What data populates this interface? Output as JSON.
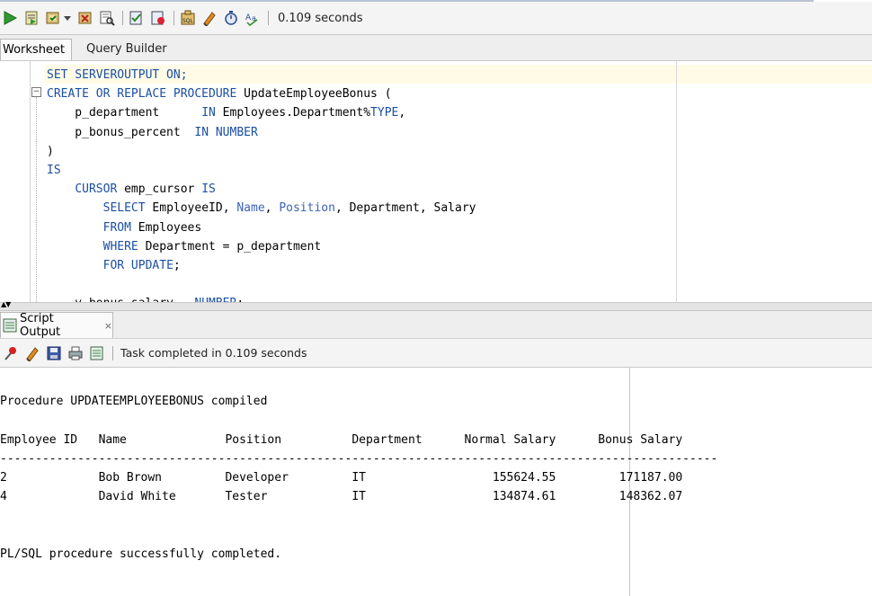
{
  "toolbar": {
    "icons": [
      "run-statement-icon",
      "run-script-icon",
      "commit-icon",
      "dropdown-arrow-icon",
      "rollback-icon",
      "explain-plan-icon",
      "autotrace-icon",
      "sql-tuning-icon",
      "sql-history-icon",
      "clear-icon",
      "timer-icon",
      "format-icon"
    ],
    "elapsed": "0.109 seconds"
  },
  "tabs": {
    "worksheet": "Worksheet",
    "query_builder": "Query Builder"
  },
  "editor": {
    "lines": [
      [
        {
          "t": "SET SERVEROUTPUT ON;",
          "c": "kw"
        }
      ],
      [
        {
          "t": "CREATE OR REPLACE PROCEDURE ",
          "c": "kw"
        },
        {
          "t": "UpdateEmployeeBonus (",
          "c": ""
        }
      ],
      [
        {
          "t": "    p_department      ",
          "c": ""
        },
        {
          "t": "IN ",
          "c": "kw"
        },
        {
          "t": "Employees.Department%",
          "c": ""
        },
        {
          "t": "TYPE",
          "c": "kw"
        },
        {
          "t": ",",
          "c": ""
        }
      ],
      [
        {
          "t": "    p_bonus_percent  ",
          "c": ""
        },
        {
          "t": "IN NUMBER",
          "c": "kw"
        }
      ],
      [
        {
          "t": ")",
          "c": ""
        }
      ],
      [
        {
          "t": "IS",
          "c": "kw"
        }
      ],
      [
        {
          "t": "    ",
          "c": ""
        },
        {
          "t": "CURSOR ",
          "c": "kw"
        },
        {
          "t": "emp_cursor ",
          "c": ""
        },
        {
          "t": "IS",
          "c": "kw"
        }
      ],
      [
        {
          "t": "        ",
          "c": ""
        },
        {
          "t": "SELECT ",
          "c": "kw"
        },
        {
          "t": "EmployeeID, ",
          "c": ""
        },
        {
          "t": "Name",
          "c": "pkw"
        },
        {
          "t": ", ",
          "c": ""
        },
        {
          "t": "Position",
          "c": "pkw"
        },
        {
          "t": ", Department, Salary",
          "c": ""
        }
      ],
      [
        {
          "t": "        ",
          "c": ""
        },
        {
          "t": "FROM ",
          "c": "kw"
        },
        {
          "t": "Employees",
          "c": ""
        }
      ],
      [
        {
          "t": "        ",
          "c": ""
        },
        {
          "t": "WHERE ",
          "c": "kw"
        },
        {
          "t": "Department = p_department",
          "c": ""
        }
      ],
      [
        {
          "t": "        ",
          "c": ""
        },
        {
          "t": "FOR UPDATE",
          "c": "kw"
        },
        {
          "t": ";",
          "c": ""
        }
      ],
      [
        {
          "t": "",
          "c": ""
        }
      ],
      [
        {
          "t": "    v_bonus_salary   ",
          "c": ""
        },
        {
          "t": "NUMBER",
          "c": "kw"
        },
        {
          "t": ";",
          "c": ""
        }
      ]
    ]
  },
  "output_panel": {
    "tab_label": "Script Output",
    "close_glyph": "×",
    "toolbar_icons": [
      "pin-icon",
      "clear-icon",
      "save-icon",
      "print-icon",
      "open-file-icon"
    ],
    "task_status": "Task completed in 0.109 seconds",
    "lines": [
      "Procedure UPDATEEMPLOYEEBONUS compiled",
      "",
      "Employee ID   Name              Position          Department      Normal Salary      Bonus Salary",
      "------------------------------------------------------------------------------------------------------",
      "2             Bob Brown         Developer         IT                  155624.55         171187.00",
      "4             David White       Tester            IT                  134874.61         148362.07",
      "",
      "",
      "PL/SQL procedure successfully completed."
    ]
  }
}
